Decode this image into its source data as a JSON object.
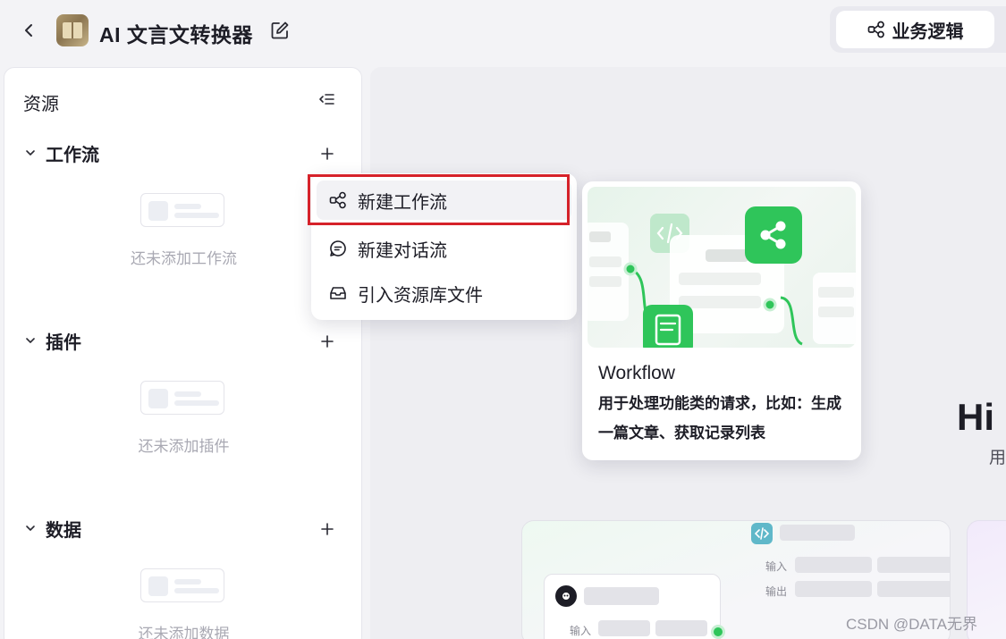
{
  "header": {
    "app_title": "AI 文言文转换器",
    "logic_button_label": "业务逻辑"
  },
  "sidebar": {
    "title": "资源",
    "sections": [
      {
        "label": "工作流",
        "empty_text": "还未添加工作流"
      },
      {
        "label": "插件",
        "empty_text": "还未添加插件"
      },
      {
        "label": "数据",
        "empty_text": "还未添加数据"
      }
    ]
  },
  "dropdown": {
    "items": [
      {
        "label": "新建工作流",
        "icon": "workflow-icon",
        "active": true
      },
      {
        "label": "新建对话流",
        "icon": "chat-flow-icon",
        "active": false
      },
      {
        "label": "引入资源库文件",
        "icon": "inbox-icon",
        "active": false
      }
    ]
  },
  "tooltip_card": {
    "title": "Workflow",
    "description": "用于处理功能类的请求，比如：生成一篇文章、获取记录列表"
  },
  "canvas": {
    "greeting": "Hi",
    "greeting_sub": "用",
    "preview_labels": {
      "input": "输入",
      "output": "输出"
    }
  },
  "colors": {
    "accent_green": "#2fc55a",
    "highlight_red": "#d6222a"
  },
  "watermark": "CSDN @DATA无界"
}
